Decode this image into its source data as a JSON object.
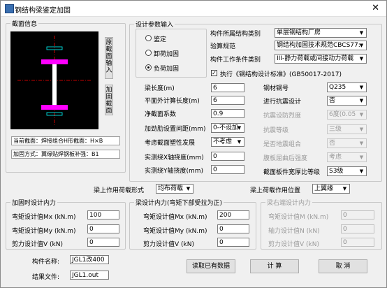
{
  "window": {
    "title": "钢结构梁鉴定加固",
    "close_glyph": "✕"
  },
  "section": {
    "label": "截面信息",
    "btn_input": "原截面输入",
    "btn_reinforce": "加固截面",
    "status1": "当前截面：焊接组合H形截面：H×B",
    "status2": "加固方式：翼缘贴焊钢板补强：B1"
  },
  "design": {
    "label": "设计参数输入",
    "radios": [
      "鉴定",
      "卸荷加固",
      "负荷加固"
    ],
    "radio_selected": 2,
    "structure_type_label": "构件所属结构类别",
    "structure_type_value": "单层钢结构厂房",
    "code_label": "验算规范",
    "code_value": "钢结构加固技术规范CBCS77:",
    "condition_label": "构件工作条件类别",
    "condition_value": "III-静力荷载或间接动力荷载",
    "execute_label": "执行《钢结构设计标准》(GB50017-2017)",
    "execute_checked": true,
    "beam_length_label": "梁长度(m)",
    "beam_length": "6",
    "lateral_length_label": "平面外计算长度(m)",
    "lateral_length": "6",
    "net_coef_label": "净截面系数",
    "net_coef": "0.9",
    "stiffener_label": "加劲肋设置间距(mm)",
    "stiffener_value": "0-不设加",
    "plastic_label": "考虑截面塑性发展",
    "plastic_value": "不考虑",
    "defl_x_label": "实测绕X轴挠度(mm)",
    "defl_x": "0",
    "defl_y_label": "实测绕Y轴挠度(mm)",
    "defl_y": "0",
    "steel_label": "钢材钢号",
    "steel_value": "Q235",
    "seismic_label": "进行抗震设计",
    "seismic_value": "否",
    "intensity_label": "抗震设防烈度",
    "intensity_value": "6度(0.05",
    "grade_label": "抗震等级",
    "grade_value": "三级",
    "combo_label": "是否地震组合",
    "combo_value": "否",
    "flange_label": "腹板屈曲后强度",
    "flange_value": "考虑",
    "ratio_label": "截面板件宽厚比等级",
    "ratio_value": "S3级"
  },
  "load": {
    "form_label": "梁上作用荷载形式",
    "form_value": "均布荷载",
    "pos_label": "梁上荷载作用位置",
    "pos_value": "上翼缘"
  },
  "reinforce_forces": {
    "label": "加固时设计内力",
    "mx_label": "弯矩设计值Mx (kN.m)",
    "mx": "100",
    "my_label": "弯矩设计值My (kN.m)",
    "my": "0",
    "v_label": "剪力设计值V (kN)",
    "v": "0"
  },
  "beam_forces": {
    "label": "梁设计内力(弯矩下部受拉为正)",
    "mx_label": "弯矩设计值Mx (kN.m)",
    "mx": "200",
    "my_label": "弯矩设计值My (kN.m)",
    "my": "0",
    "v_label": "剪力设计值V (kN)",
    "v": "0"
  },
  "right_end": {
    "label": "梁右端设计内力",
    "m_label": "弯矩设计值M (kN.m)",
    "m": "0",
    "n_label": "轴力设计值N (kN)",
    "n": "0",
    "v_label": "剪力设计值V (kN)",
    "v": "0"
  },
  "footer": {
    "name_label": "构件名称:",
    "name_value": "JGL1改400",
    "file_label": "结果文件:",
    "file_value": "JGL1.out",
    "read_btn": "读取已有数据",
    "calc_btn": "计 算",
    "cancel_btn": "取 消"
  },
  "colors": {
    "flange": "#ff00ff",
    "web": "#ffffff",
    "canvas": "#000000",
    "centerline": "#ff0000",
    "plate": "#00ffff"
  }
}
